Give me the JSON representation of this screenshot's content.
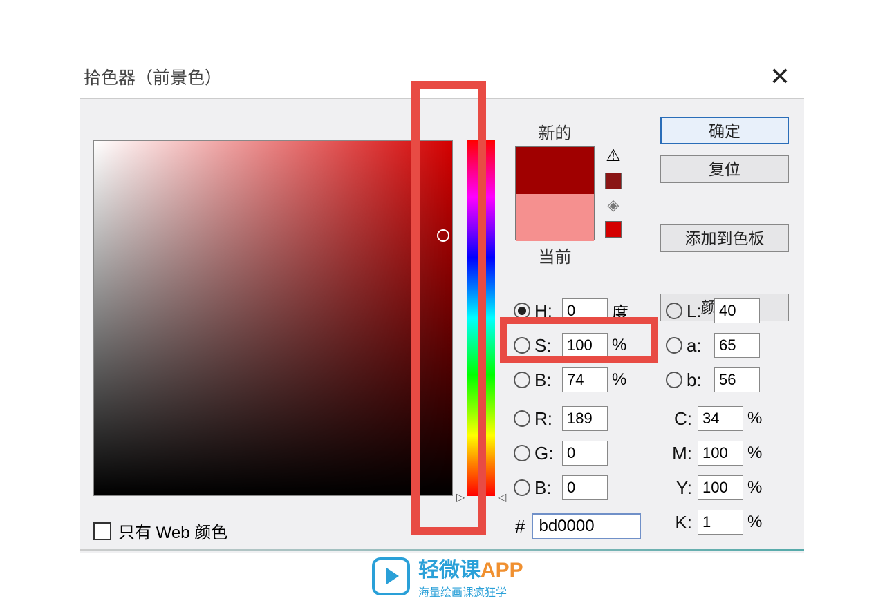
{
  "title": "拾色器（前景色）",
  "close_glyph": "✕",
  "preview": {
    "new_label": "新的",
    "current_label": "当前",
    "new_color": "#a00000",
    "current_color": "#f5908f"
  },
  "warning_swatch1": "#8a1515",
  "warning_swatch2": "#d40000",
  "buttons": {
    "ok": "确定",
    "reset": "复位",
    "add_swatch": "添加到色板",
    "color_lib": "颜色库"
  },
  "hsb": {
    "h": {
      "label": "H:",
      "value": "0",
      "unit": "度",
      "selected": true
    },
    "s": {
      "label": "S:",
      "value": "100",
      "unit": "%",
      "selected": false
    },
    "b": {
      "label": "B:",
      "value": "74",
      "unit": "%",
      "selected": false
    }
  },
  "lab": {
    "l": {
      "label": "L:",
      "value": "40"
    },
    "a": {
      "label": "a:",
      "value": "65"
    },
    "b": {
      "label": "b:",
      "value": "56"
    }
  },
  "rgb": {
    "r": {
      "label": "R:",
      "value": "189"
    },
    "g": {
      "label": "G:",
      "value": "0"
    },
    "b": {
      "label": "B:",
      "value": "0"
    }
  },
  "cmyk": {
    "c": {
      "label": "C:",
      "value": "34",
      "unit": "%"
    },
    "m": {
      "label": "M:",
      "value": "100",
      "unit": "%"
    },
    "y": {
      "label": "Y:",
      "value": "100",
      "unit": "%"
    },
    "k": {
      "label": "K:",
      "value": "1",
      "unit": "%"
    }
  },
  "hex": {
    "hash": "#",
    "value": "bd0000"
  },
  "web_only": {
    "label": "只有 Web 颜色"
  },
  "watermark": {
    "line1a": "轻微课",
    "line1b": "APP",
    "line2": "海量绘画课疯狂学"
  }
}
